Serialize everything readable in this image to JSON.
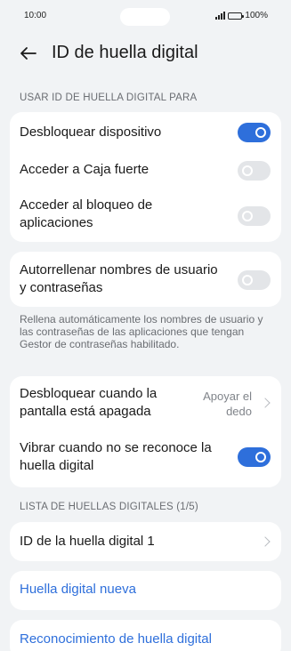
{
  "status": {
    "time": "10:00",
    "battery": "100%"
  },
  "header": {
    "title": "ID de huella digital"
  },
  "section_use": {
    "label": "USAR ID DE HUELLA DIGITAL PARA"
  },
  "use_items": [
    {
      "label": "Desbloquear dispositivo",
      "enabled": true
    },
    {
      "label": "Acceder a Caja fuerte",
      "enabled": false
    },
    {
      "label": "Acceder al bloqueo de aplicaciones",
      "enabled": false
    }
  ],
  "autofill": {
    "label": "Autorrellenar nombres de usuario y contraseñas",
    "enabled": false,
    "hint": "Rellena automáticamente los nombres de usuario y las contraseñas de las aplicaciones que tengan Gestor de contraseñas habilitado."
  },
  "screen_off": {
    "label": "Desbloquear cuando la pantalla está apagada",
    "value": "Apoyar el dedo"
  },
  "vibrate": {
    "label": "Vibrar cuando no se reconoce la huella digital",
    "enabled": true
  },
  "section_list": {
    "label": "LISTA DE HUELLAS DIGITALES (1/5)"
  },
  "fingerprints": [
    {
      "label": "ID de la huella digital 1"
    }
  ],
  "new_fingerprint": {
    "label": "Huella digital nueva"
  },
  "recognition": {
    "label": "Reconocimiento de huella digital"
  },
  "colors": {
    "accent": "#2e6fdb",
    "background": "#f1f3f5",
    "card": "#ffffff"
  },
  "icons": {
    "back": "arrow-left-icon",
    "chevron": "chevron-right-icon",
    "signal": "signal-icon",
    "battery": "battery-icon"
  }
}
